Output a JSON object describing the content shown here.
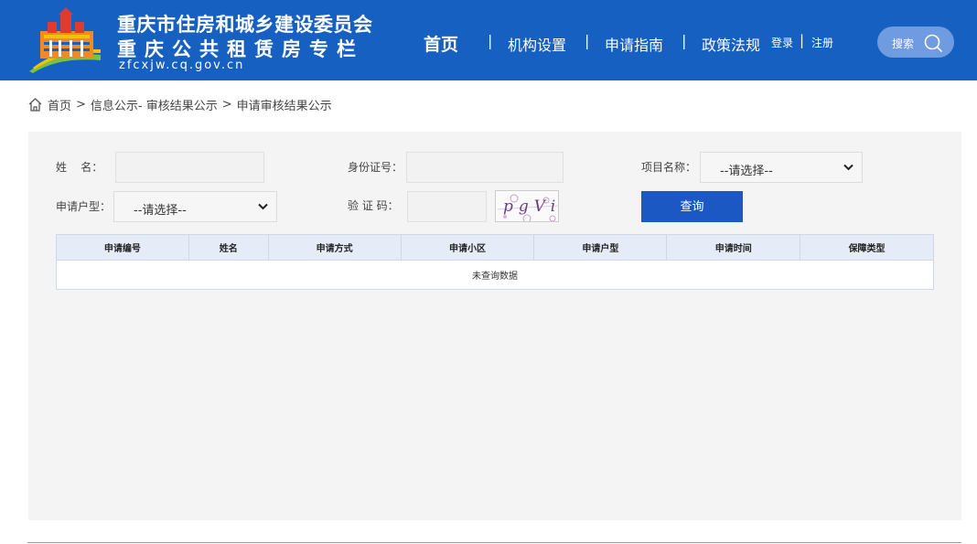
{
  "header": {
    "title_line1": "重庆市住房和城乡建设委员会",
    "title_line2": "重庆公共租赁房专栏",
    "domain": "zfcxjw.cq.gov.cn",
    "nav": {
      "home": "首页",
      "sep": "|",
      "org": "机构设置",
      "guide": "申请指南",
      "policy": "政策法规",
      "login": "登录",
      "register": "注册"
    },
    "search_label": "搜索",
    "colors": {
      "header_bg": "#1560c0",
      "search_bg": "#6f9be0",
      "button_bg": "#1b58c4"
    }
  },
  "breadcrumb": {
    "icon": "home-icon",
    "items": [
      "首页",
      "信息公示- 审核结果公示",
      "申请审核结果公示"
    ],
    "separator": ">"
  },
  "form": {
    "name_label": "姓    名：",
    "name_value": "",
    "id_label": "身份证号：",
    "id_value": "",
    "project_label": "项目名称：",
    "project_selected": "--请选择--",
    "type_label": "申请户型：",
    "type_selected": "--请选择--",
    "captcha_label": "验 证 码：",
    "captcha_value": "",
    "captcha_text": "pgVi",
    "query_button": "查询"
  },
  "table": {
    "columns": [
      "申请编号",
      "姓名",
      "申请方式",
      "申请小区",
      "申请户型",
      "申请时间",
      "保障类型"
    ],
    "empty_message": "未查询数据"
  }
}
